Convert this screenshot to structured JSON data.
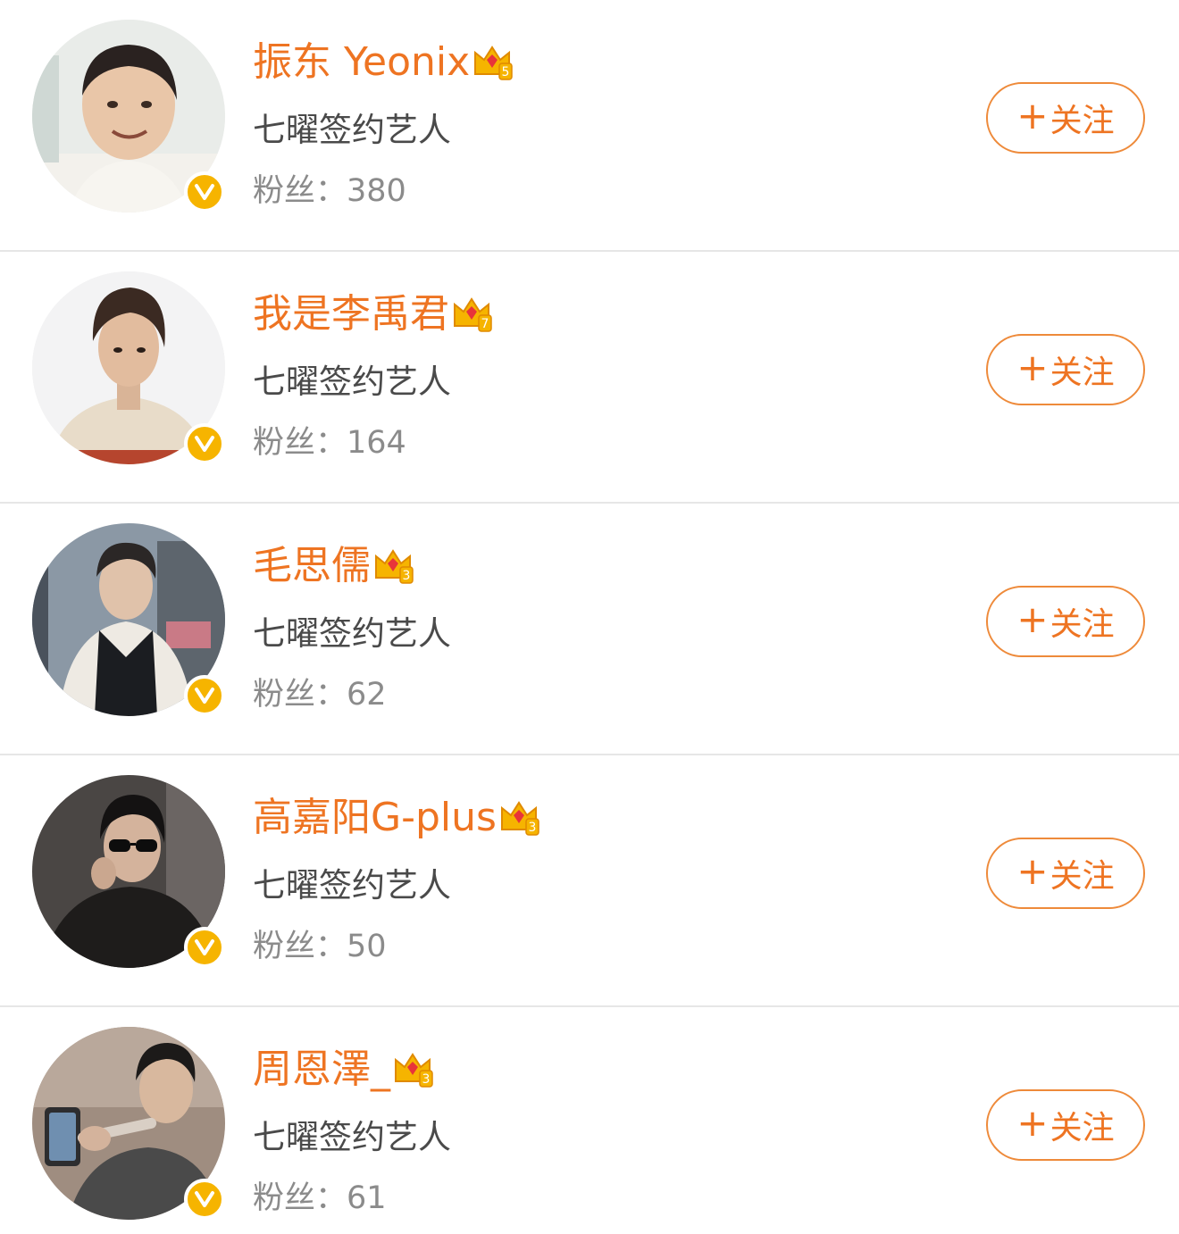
{
  "users": [
    {
      "name": "振东 Yeonix",
      "crown_level": "5",
      "description": "七曜签约艺人",
      "fans_label": "粉丝：",
      "fans_count": "380",
      "follow_label": "关注",
      "follow_icon": "plus-icon",
      "avatar_colors": [
        "#e9ece9",
        "#f4f3ef"
      ]
    },
    {
      "name": "我是李禹君",
      "crown_level": "7",
      "description": "七曜签约艺人",
      "fans_label": "粉丝：",
      "fans_count": "164",
      "follow_label": "关注",
      "follow_icon": "plus-icon",
      "avatar_colors": [
        "#f3f3f4",
        "#e8dcc9"
      ]
    },
    {
      "name": "毛思儒",
      "crown_level": "3",
      "description": "七曜签约艺人",
      "fans_label": "粉丝：",
      "fans_count": "62",
      "follow_label": "关注",
      "follow_icon": "plus-icon",
      "avatar_colors": [
        "#8b98a5",
        "#4a525c"
      ]
    },
    {
      "name": "高嘉阳G-plus",
      "crown_level": "3",
      "description": "七曜签约艺人",
      "fans_label": "粉丝：",
      "fans_count": "50",
      "follow_label": "关注",
      "follow_icon": "plus-icon",
      "avatar_colors": [
        "#4a4644",
        "#1e1c1b"
      ]
    },
    {
      "name": "周恩澤_",
      "crown_level": "3",
      "description": "七曜签约艺人",
      "fans_label": "粉丝：",
      "fans_count": "61",
      "follow_label": "关注",
      "follow_icon": "plus-icon",
      "avatar_colors": [
        "#9f8d80",
        "#4a4a4a"
      ]
    }
  ],
  "colors": {
    "name": "#ee7422",
    "button_border": "#ee8a3a",
    "verified_badge": "#f6b400",
    "divider": "#e6e6e6",
    "description": "#4a4a4a",
    "fans": "#8b8b8b"
  },
  "badges": {
    "verified_icon": "verified-v-icon",
    "crown_icon": "crown-icon"
  }
}
